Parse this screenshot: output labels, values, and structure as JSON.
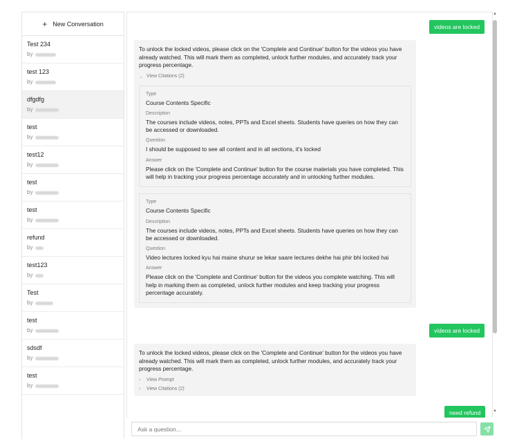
{
  "sidebar": {
    "new_conversation_label": "New Conversation",
    "by_prefix": "by",
    "items": [
      {
        "title": "Test 234",
        "active": false
      },
      {
        "title": "test 123",
        "active": false
      },
      {
        "title": "dfgdfg",
        "active": true
      },
      {
        "title": "test",
        "active": false
      },
      {
        "title": "test12",
        "active": false
      },
      {
        "title": "test",
        "active": false
      },
      {
        "title": "test",
        "active": false
      },
      {
        "title": "refund",
        "active": false
      },
      {
        "title": "test123",
        "active": false
      },
      {
        "title": "Test",
        "active": false
      },
      {
        "title": "test",
        "active": false
      },
      {
        "title": "sdsdf",
        "active": false
      },
      {
        "title": "test",
        "active": false
      }
    ]
  },
  "chat": {
    "messages": {
      "user1": "videos are locked",
      "bot1": "To unlock the locked videos, please click on the 'Complete and Continue' button for the videos you have already watched. This will mark them as completed, unlock further modules, and accurately track your progress percentage.",
      "bot1_citations_toggle": "View Citations (2)",
      "user2": "videos are locked",
      "bot2": "To unlock the locked videos, please click on the 'Complete and Continue' button for the videos you have already watched. This will mark them as completed, unlock further modules, and accurately track your progress percentage.",
      "bot2_prompt_toggle": "View Prompt",
      "bot2_citations_toggle": "View Citations (2)",
      "user3": "need refund"
    },
    "citation_labels": {
      "type": "Type",
      "description": "Description",
      "question": "Question",
      "answer": "Answer"
    },
    "citations": [
      {
        "type": "Course Contents Specific",
        "description": "The courses include videos, notes, PPTs and Excel sheets. Students have queries on how they can be accessed or downloaded.",
        "question": "I should be supposed to see all content and in all sections, it's locked",
        "answer": "Please click on the 'Complete and Continue' button for the course materials you have completed. This will help in tracking your progress percentage accurately and in unlocking further modules."
      },
      {
        "type": "Course Contents Specific",
        "description": "The courses include videos, notes, PPTs and Excel sheets. Students have queries on how they can be accessed or downloaded.",
        "question": "Video lectures locked kyu hai maine shurur se lekar saare lectures dekhe hai phir bhi locked hai",
        "answer": "Please click on the 'Complete and Continue' button for the videos you complete watching. This will help in marking them as completed, unlock further modules and keep tracking your progress percentage accurately."
      }
    ]
  },
  "input": {
    "placeholder": "Ask a question..."
  },
  "colors": {
    "accent": "#22c55e",
    "send_button": "#86e0a6"
  },
  "icons": {
    "new_conversation": "plus-icon",
    "toggle": "chevron-icon",
    "send": "send-icon"
  }
}
